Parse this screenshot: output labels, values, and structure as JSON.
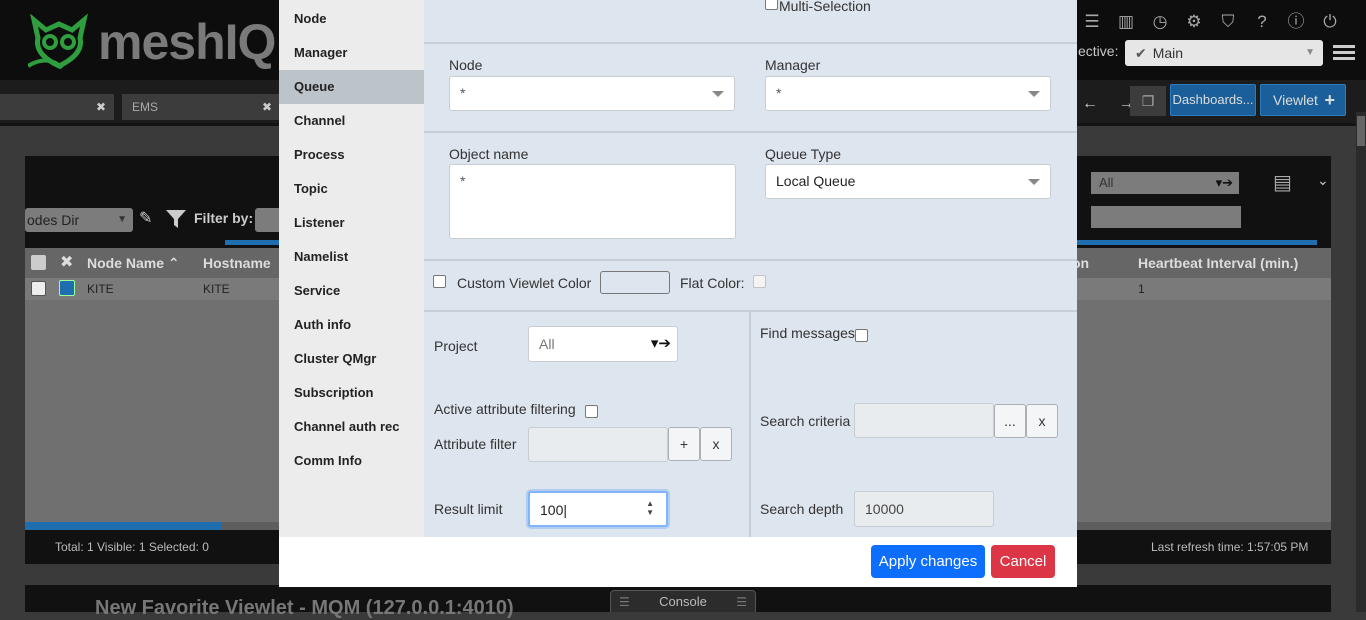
{
  "header": {
    "logo_text": "meshIQ",
    "logo_tm": "™",
    "perspective_label": "ective:",
    "perspective_value": "Main",
    "icons": [
      "chart-icon",
      "clock-icon",
      "gear-icon",
      "shield-icon",
      "help-icon",
      "info-icon",
      "power-icon"
    ]
  },
  "tabs": {
    "tab1_label": "",
    "tab2_label": "EMS",
    "dashboards_label": "Dashboards...",
    "viewlet_label": "Viewlet"
  },
  "panel": {
    "nodes_dir": "odes Dir",
    "filter_label": "Filter by:",
    "project_select": "All",
    "columns": [
      "Node Name",
      "Hostname",
      "on",
      "Heartbeat Interval (min.)"
    ],
    "row": {
      "node_name": "KITE",
      "hostname": "KITE",
      "heartbeat": "1"
    },
    "footer_left": "Total: 1 Visible: 1 Selected: 0",
    "footer_right": "Last refresh time: 1:57:05 PM"
  },
  "bottom": {
    "title": "New Favorite Viewlet - MQM (127.0.0.1:4010)",
    "console": "Console"
  },
  "modal": {
    "nav": [
      "Node",
      "Manager",
      "Queue",
      "Channel",
      "Process",
      "Topic",
      "Listener",
      "Namelist",
      "Service",
      "Auth info",
      "Cluster QMgr",
      "Subscription",
      "Channel auth rec",
      "Comm Info"
    ],
    "nav_active": "Queue",
    "multi_selection": "Multi-Selection",
    "node_label": "Node",
    "node_value": "*",
    "manager_label": "Manager",
    "manager_value": "*",
    "object_name_label": "Object name",
    "object_name_value": "*",
    "queue_type_label": "Queue Type",
    "queue_type_value": "Local Queue",
    "custom_color_label": "Custom Viewlet Color",
    "flat_color_label": "Flat Color:",
    "project_label": "Project",
    "project_value": "All",
    "active_filter_label": "Active attribute filtering",
    "attribute_filter_label": "Attribute filter",
    "attr_add": "+",
    "attr_clear": "x",
    "result_limit_label": "Result limit",
    "result_limit_value": "100",
    "find_messages_label": "Find messages",
    "search_criteria_label": "Search criteria",
    "search_more": "...",
    "search_clear": "x",
    "search_depth_label": "Search depth",
    "search_depth_value": "10000",
    "apply_label": "Apply changes",
    "cancel_label": "Cancel"
  }
}
